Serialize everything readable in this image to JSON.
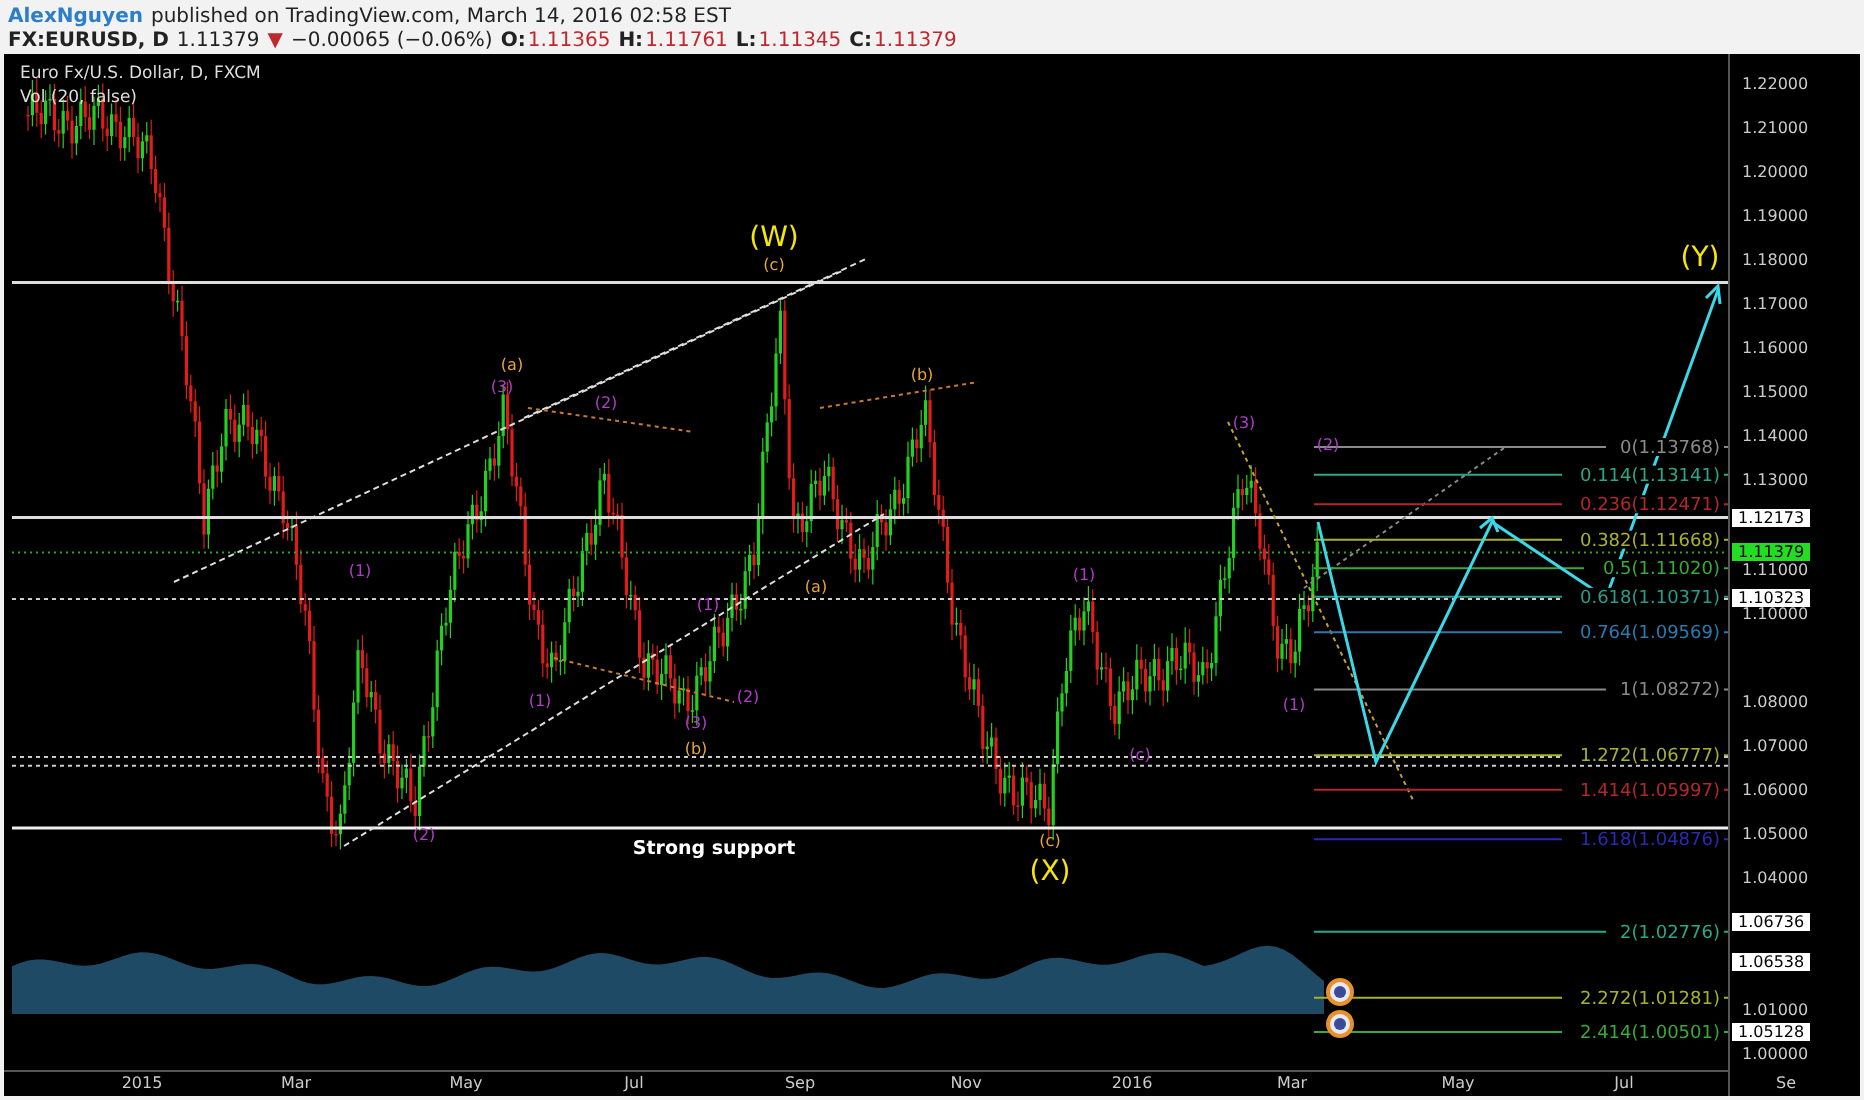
{
  "header": {
    "author": "AlexNguyen",
    "published": "published on TradingView.com, March 14, 2016 02:58 EST"
  },
  "quote": {
    "symbol": "FX:EURUSD, D",
    "last": "1.11379",
    "change_arrow": "▼",
    "change": "−0.00065 (−0.06%)",
    "ohlc": [
      {
        "label": "O:",
        "value": "1.11365"
      },
      {
        "label": "H:",
        "value": "1.11761"
      },
      {
        "label": "L:",
        "value": "1.11345"
      },
      {
        "label": "C:",
        "value": "1.11379"
      }
    ]
  },
  "chart": {
    "title": "Euro Fx/U.S. Dollar, D, FXCM",
    "indicator": "Vol (20, false)",
    "annotation": "Strong support",
    "price_axis": [
      "1.22000",
      "1.21000",
      "1.20000",
      "1.19000",
      "1.18000",
      "1.17000",
      "1.16000",
      "1.15000",
      "1.14000",
      "1.13000",
      "1.11000",
      "1.10000",
      "1.08000",
      "1.07000",
      "1.06000",
      "1.05000",
      "1.04000",
      "1.01000",
      "1.00000"
    ],
    "price_badges": [
      {
        "value": "1.12173",
        "color": "#ffffff"
      },
      {
        "value": "1.11379",
        "color": "#22dd22"
      },
      {
        "value": "1.10323",
        "color": "#ffffff"
      },
      {
        "value": "1.06736",
        "color": "#ffffff"
      },
      {
        "value": "1.06538",
        "color": "#ffffff"
      },
      {
        "value": "1.05128",
        "color": "#ffffff"
      }
    ],
    "time_axis": [
      "2015",
      "Mar",
      "May",
      "Jul",
      "Sep",
      "Nov",
      "2016",
      "Mar",
      "May",
      "Jul",
      "Se"
    ],
    "fib_levels": [
      {
        "label": "0(1.13768)",
        "color": "#8a8a8a"
      },
      {
        "label": "0.114(1.13141)",
        "color": "#2aa88a"
      },
      {
        "label": "0.236(1.12471)",
        "color": "#b0282a"
      },
      {
        "label": "0.382(1.11668)",
        "color": "#a8b030"
      },
      {
        "label": "0.5(1.11020)",
        "color": "#3aa83a"
      },
      {
        "label": "0.618(1.10371)",
        "color": "#2a9a8a"
      },
      {
        "label": "0.764(1.09569)",
        "color": "#2a7ab0"
      },
      {
        "label": "1(1.08272)",
        "color": "#8a8a8a"
      },
      {
        "label": "1.272(1.06777)",
        "color": "#a8b030"
      },
      {
        "label": "1.414(1.05997)",
        "color": "#b0282a"
      },
      {
        "label": "1.618(1.04876)",
        "color": "#2a2ab0"
      },
      {
        "label": "2(1.02776)",
        "color": "#2aa88a"
      },
      {
        "label": "2.272(1.01281)",
        "color": "#a8b030"
      },
      {
        "label": "2.414(1.00501)",
        "color": "#3aa83a"
      }
    ],
    "wave_labels": [
      {
        "text": "(W)",
        "kind": "major",
        "color": "#f5e50a"
      },
      {
        "text": "(c)",
        "kind": "minor",
        "color": "#e8a33c"
      },
      {
        "text": "(a)",
        "kind": "minor",
        "color": "#e8a33c"
      },
      {
        "text": "(3)",
        "kind": "minor",
        "color": "#b03cc8"
      },
      {
        "text": "(2)",
        "kind": "minor",
        "color": "#b03cc8"
      },
      {
        "text": "(b)",
        "kind": "minor",
        "color": "#e8a33c"
      },
      {
        "text": "(1)",
        "kind": "minor",
        "color": "#b03cc8"
      },
      {
        "text": "(1)",
        "kind": "minor",
        "color": "#b03cc8"
      },
      {
        "text": "(a)",
        "kind": "minor",
        "color": "#e8a33c"
      },
      {
        "text": "(1)",
        "kind": "minor",
        "color": "#b03cc8"
      },
      {
        "text": "(2)",
        "kind": "minor",
        "color": "#b03cc8"
      },
      {
        "text": "(3)",
        "kind": "minor",
        "color": "#b03cc8"
      },
      {
        "text": "(b)",
        "kind": "minor",
        "color": "#e8a33c"
      },
      {
        "text": "(2)",
        "kind": "minor",
        "color": "#b03cc8"
      },
      {
        "text": "(1)",
        "kind": "minor",
        "color": "#b03cc8"
      },
      {
        "text": "(c)",
        "kind": "minor",
        "color": "#b03cc8"
      },
      {
        "text": "(3)",
        "kind": "minor",
        "color": "#b03cc8"
      },
      {
        "text": "(2)",
        "kind": "minor",
        "color": "#b03cc8"
      },
      {
        "text": "(1)",
        "kind": "minor",
        "color": "#b03cc8"
      },
      {
        "text": "(c)",
        "kind": "minor",
        "color": "#e8a33c"
      },
      {
        "text": "(X)",
        "kind": "major",
        "color": "#f5e50a"
      },
      {
        "text": "(Y)",
        "kind": "major",
        "color": "#f5e50a"
      }
    ]
  }
}
